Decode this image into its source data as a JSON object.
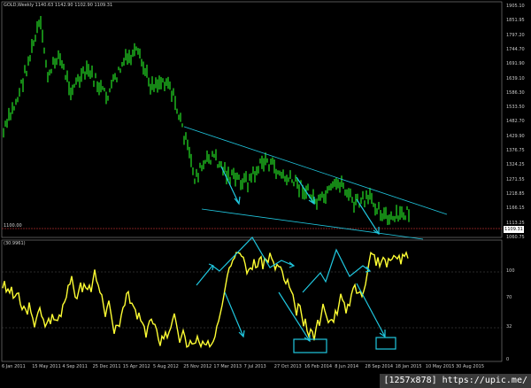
{
  "main_pane": {
    "header": "GOLD,Weekly  1140.63  1142.90  1102.90  1109.31",
    "price_badge": "1109.31",
    "sub_header": "1100.00",
    "y_ticks": [
      "1905.10",
      "1851.95",
      "1797.20",
      "1744.70",
      "1691.90",
      "1639.10",
      "1586.30",
      "1533.50",
      "1482.70",
      "1429.90",
      "1376.75",
      "1324.25",
      "1271.55",
      "1218.85",
      "1166.15",
      "1113.25",
      "1060.75"
    ]
  },
  "indicator_pane": {
    "header": "(30.9961)",
    "y_ticks": [
      "100",
      "70",
      "32",
      "0"
    ]
  },
  "x_axis": {
    "ticks": [
      "6 Jan 2011",
      "15 May 2011",
      "4 Sep 2011",
      "25 Dec 2011",
      "15 Apr 2012",
      "5 Aug 2012",
      "25 Nov 2012",
      "17 Mar 2013",
      "7 Jul 2013",
      "27 Oct 2013",
      "16 Feb 2014",
      "8 Jun 2014",
      "28 Sep 2014",
      "18 Jan 2015",
      "10 May 2015",
      "30 Aug 2015"
    ]
  },
  "colors": {
    "background": "#000000",
    "candles": "#22d022",
    "oscillator": "#ffff33",
    "annotation": "#20c8e0",
    "grid": "#555555"
  },
  "watermark": "[1257x878] https://upic.me/"
}
